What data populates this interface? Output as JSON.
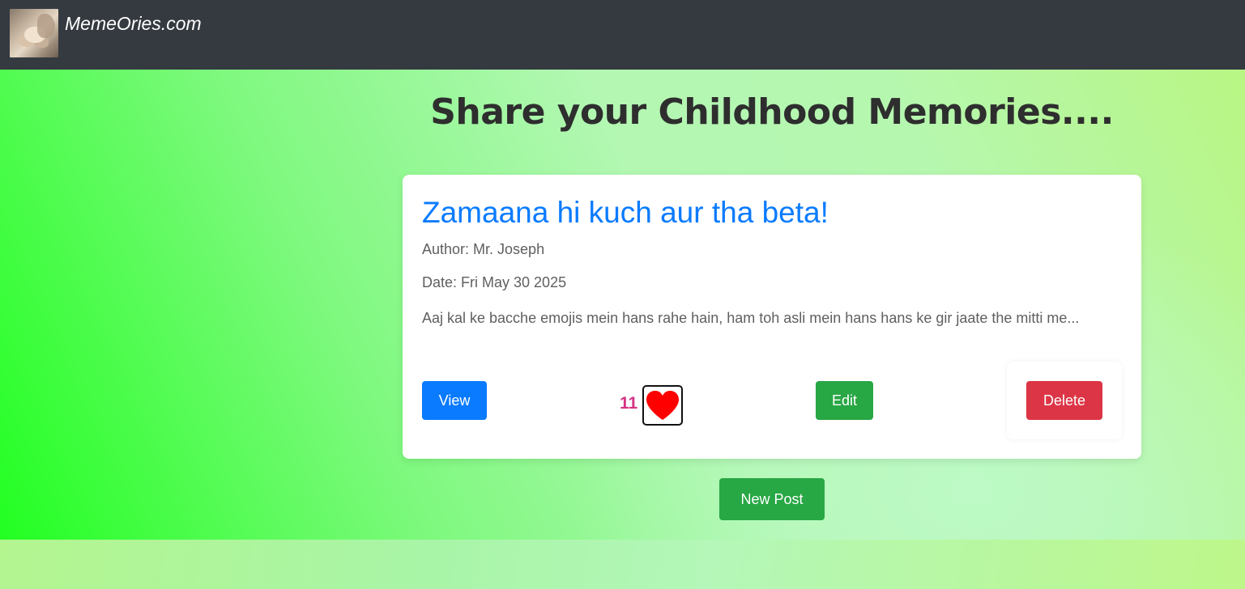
{
  "navbar": {
    "brand": "MemeOries.com",
    "logo_icon": "baby-hand-photo"
  },
  "page": {
    "heading": "Share your Childhood Memories...."
  },
  "post": {
    "title": "Zamaana hi kuch aur tha beta!",
    "author": "Author: Mr. Joseph",
    "date": "Date: Fri May 30 2025",
    "excerpt": "Aaj kal ke bacche emojis mein hans rahe hain, ham toh asli mein hans hans ke gir jaate the mitti me...",
    "view_label": "View",
    "like_count": "11",
    "like_icon": "heart-icon",
    "edit_label": "Edit",
    "delete_label": "Delete"
  },
  "actions": {
    "new_post_label": "New Post"
  },
  "colors": {
    "navbar": "#343a40",
    "primary": "#0a7bff",
    "success": "#28a745",
    "danger": "#dc3545",
    "like_count": "#d63384",
    "heart": "#ff0000"
  }
}
